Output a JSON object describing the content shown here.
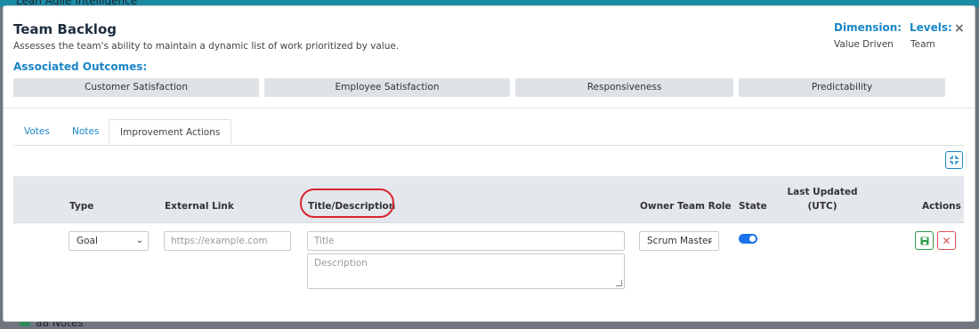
{
  "background": {
    "app_title_partial": "Lean Agile Intelligence",
    "bottom_text_partial": "a8 Notes"
  },
  "modal": {
    "title": "Team Backlog",
    "subtitle": "Assesses the team's ability to maintain a dynamic list of work prioritized by value.",
    "dimension_label": "Dimension:",
    "dimension_value": "Value Driven",
    "levels_label": "Levels:",
    "levels_value": "Team",
    "close_label": "×",
    "outcomes_heading": "Associated Outcomes:",
    "outcomes": [
      "Customer Satisfaction",
      "Employee Satisfaction",
      "Responsiveness",
      "Predictability"
    ]
  },
  "tabs": [
    {
      "label": "Votes",
      "active": false
    },
    {
      "label": "Notes",
      "active": false
    },
    {
      "label": "Improvement Actions",
      "active": true
    }
  ],
  "table": {
    "columns": {
      "type": "Type",
      "external_link": "External Link",
      "title_description": "Title/Description",
      "owner_team_role": "Owner Team Role",
      "state": "State",
      "last_updated_line1": "Last Updated",
      "last_updated_line2": "(UTC)",
      "actions": "Actions"
    },
    "row": {
      "type_value": "Goal",
      "external_link_placeholder": "https://example.com",
      "title_placeholder": "Title",
      "description_placeholder": "Description",
      "owner_role_value": "Scrum Master",
      "state_on": true,
      "last_updated": "",
      "cancel_label": "✕"
    }
  },
  "colors": {
    "accent": "#1a86c7",
    "highlight_ring": "#d9242e",
    "save_green": "#2e9c4a",
    "cancel_red": "#d9534f",
    "toggle_on": "#1a73e8"
  }
}
